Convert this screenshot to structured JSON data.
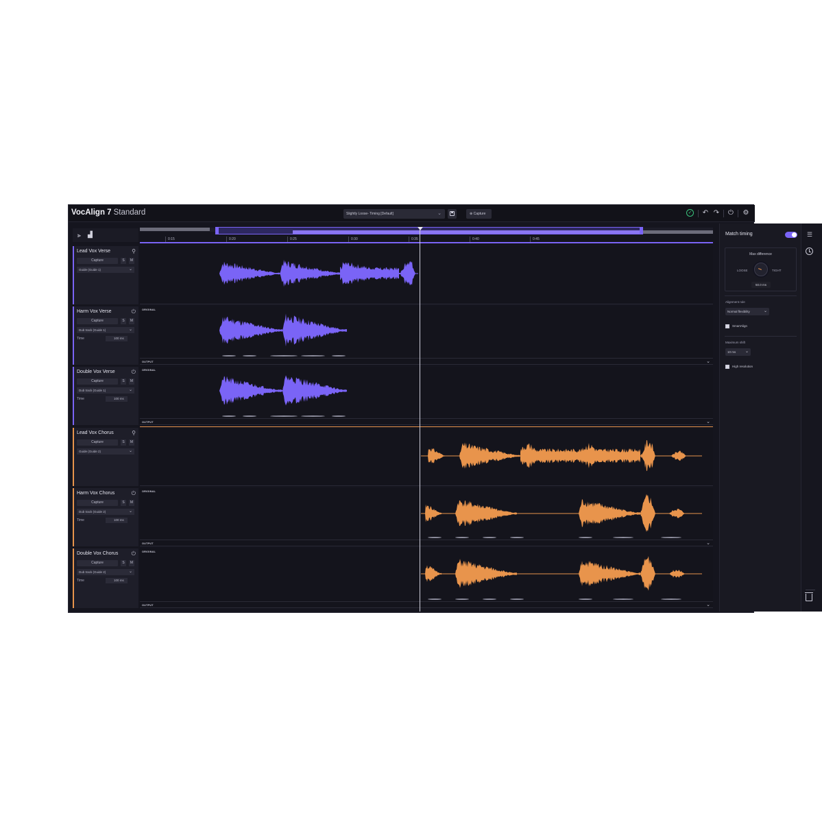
{
  "app": {
    "title": "VocAlign 7",
    "edition": "Standard"
  },
  "toolbar": {
    "preset_label": "Slightly Loose- Timing [Default]",
    "capture_label": "Capture"
  },
  "timeline": {
    "ticks": [
      "0:15",
      "0:20",
      "0:25",
      "0:30",
      "0:35",
      "0:40",
      "0:45"
    ]
  },
  "tracks": [
    {
      "name": "Lead Vox Verse",
      "capture": "Capture",
      "s": "S",
      "m": "M",
      "guide": "Guide (Guide 1)",
      "role": "guide",
      "color": "#7a64f6"
    },
    {
      "name": "Harm Vox Verse",
      "capture": "Capture",
      "s": "S",
      "m": "M",
      "guide": "Dub track (Guide 1)",
      "time_label": "Time",
      "time_value": "100",
      "time_unit": "ms",
      "role": "dub",
      "color": "#7a64f6"
    },
    {
      "name": "Double Vox Verse",
      "capture": "Capture",
      "s": "S",
      "m": "M",
      "guide": "Dub track (Guide 1)",
      "time_label": "Time",
      "time_value": "100",
      "time_unit": "ms",
      "role": "dub",
      "color": "#7a64f6"
    },
    {
      "name": "Lead Vox Chorus",
      "capture": "Capture",
      "s": "S",
      "m": "M",
      "guide": "Guide (Guide 2)",
      "role": "guide",
      "color": "#e8944c"
    },
    {
      "name": "Harm Vox Chorus",
      "capture": "Capture",
      "s": "S",
      "m": "M",
      "guide": "Dub track (Guide 2)",
      "time_label": "Time",
      "time_value": "100",
      "time_unit": "ms",
      "role": "dub",
      "color": "#e8944c"
    },
    {
      "name": "Double Vox Chorus",
      "capture": "Capture",
      "s": "S",
      "m": "M",
      "guide": "Dub track (Guide 2)",
      "time_label": "Time",
      "time_value": "100",
      "time_unit": "ms",
      "role": "dub",
      "color": "#e8944c"
    }
  ],
  "lane_labels": {
    "original": "ORIGINAL",
    "output": "OUTPUT"
  },
  "panel": {
    "match_timing": "Match timing",
    "match_timing_on": true,
    "max_difference": "Max difference",
    "loose": "LOOSE",
    "tight": "TIGHT",
    "max_difference_value": "50.0 ms",
    "alignment_rule_label": "Alignment rule",
    "alignment_rule_value": "Normal flexibility",
    "smartalign_label": "SmartAlign",
    "maximum_shift_label": "Maximum shift",
    "maximum_shift_value": "10 ms",
    "high_resolution_label": "High resolution"
  },
  "icons": {
    "status": "check-circle-icon",
    "undo": "undo-icon",
    "redo": "redo-icon",
    "power": "power-icon",
    "settings": "gear-icon",
    "save": "save-icon",
    "list": "list-icon",
    "history": "history-icon",
    "trash": "trash-icon"
  },
  "colors": {
    "verse": "#7a64f6",
    "chorus": "#e8944c",
    "ok": "#3ac47d"
  }
}
